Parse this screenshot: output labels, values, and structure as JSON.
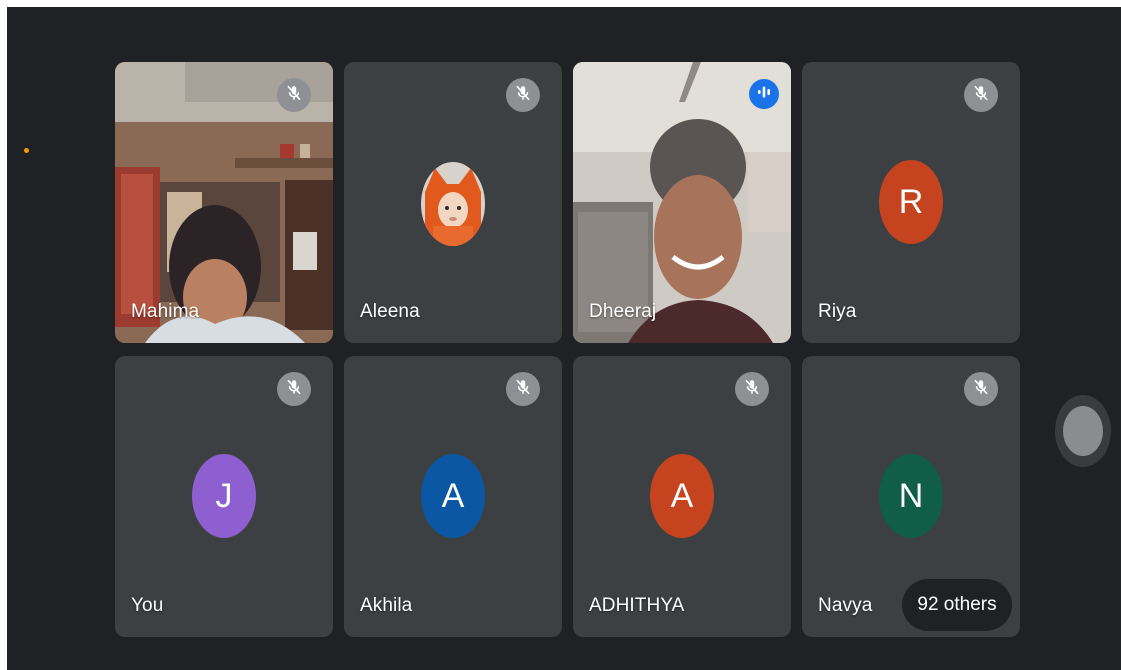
{
  "participants": [
    {
      "name": "Mahima",
      "muted": true,
      "view": "video"
    },
    {
      "name": "Aleena",
      "muted": true,
      "view": "photo-avatar"
    },
    {
      "name": "Dheeraj",
      "muted": false,
      "speaking": true,
      "view": "video"
    },
    {
      "name": "Riya",
      "muted": true,
      "initial": "R",
      "color": "#c5431f"
    },
    {
      "name": "You",
      "muted": true,
      "initial": "J",
      "color": "#8e5fd1"
    },
    {
      "name": "Akhila",
      "muted": true,
      "initial": "A",
      "color": "#0b57a4"
    },
    {
      "name": "ADHITHYA",
      "muted": true,
      "initial": "A",
      "color": "#c5431f"
    },
    {
      "name": "Navya",
      "muted": true,
      "initial": "N",
      "color": "#0f5e45"
    }
  ],
  "others_label": "92 others",
  "colors": {
    "background": "#202124",
    "tile": "#3c4043",
    "mic_off_bg": "#8e9094",
    "speaking_bg": "#1a73e8",
    "notification_dot": "#f29900"
  },
  "icons": {
    "muted": "mic-off-icon",
    "speaking": "audio-wave-icon",
    "side_control": "circle-button-icon"
  }
}
